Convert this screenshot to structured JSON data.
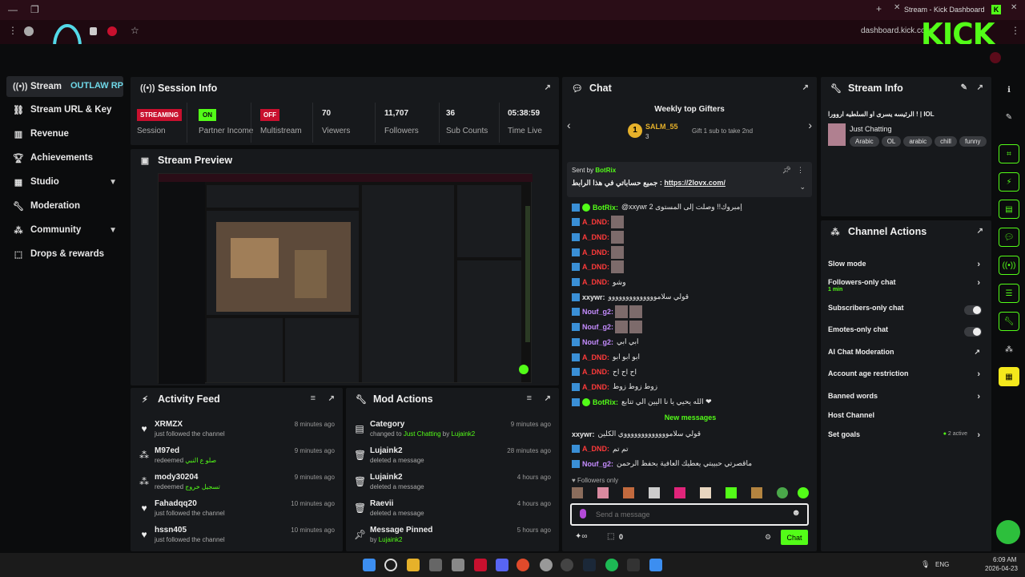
{
  "browser": {
    "tab_title": "Stream - Kick Dashboard",
    "url": "dashboard.kick.com",
    "overlay_logo": "KICK",
    "overlay_name": "OUTLAW RP"
  },
  "sidebar": {
    "items": [
      {
        "label": "Stream",
        "icon": "broadcast-icon"
      },
      {
        "label": "Stream URL & Key",
        "icon": "link-icon"
      },
      {
        "label": "Revenue",
        "icon": "chart-icon"
      },
      {
        "label": "Achievements",
        "icon": "trophy-icon"
      },
      {
        "label": "Studio",
        "icon": "studio-icon"
      },
      {
        "label": "Moderation",
        "icon": "wrench-icon"
      },
      {
        "label": "Community",
        "icon": "community-icon"
      },
      {
        "label": "Drops & rewards",
        "icon": "gift-icon"
      }
    ]
  },
  "session": {
    "title": "Session Info",
    "stats": [
      {
        "value": "STREAMING",
        "label": "Session"
      },
      {
        "value": "ON",
        "label": "Partner Income"
      },
      {
        "value": "OFF",
        "label": "Multistream"
      },
      {
        "value": "70",
        "label": "Viewers"
      },
      {
        "value": "11,707",
        "label": "Followers"
      },
      {
        "value": "36",
        "label": "Sub Counts"
      },
      {
        "value": "05:38:59",
        "label": "Time Live"
      }
    ]
  },
  "preview": {
    "title": "Stream Preview"
  },
  "activity": {
    "title": "Activity Feed",
    "rows": [
      {
        "name": "XRMZX",
        "sub": "just followed the channel",
        "extra": "",
        "time": "8 minutes ago",
        "icon": "heart-icon"
      },
      {
        "name": "M97ed",
        "sub": "redeemed",
        "extra": "صلو ع النبي",
        "time": "9 minutes ago",
        "icon": "redeem-icon"
      },
      {
        "name": "mody30204",
        "sub": "redeemed",
        "extra": "تسجيل خروج",
        "time": "9 minutes ago",
        "icon": "redeem-icon"
      },
      {
        "name": "Fahadqq20",
        "sub": "just followed the channel",
        "extra": "",
        "time": "10 minutes ago",
        "icon": "heart-icon"
      },
      {
        "name": "hssn405",
        "sub": "just followed the channel",
        "extra": "",
        "time": "10 minutes ago",
        "icon": "heart-icon"
      }
    ]
  },
  "mod": {
    "title": "Mod Actions",
    "rows": [
      {
        "name": "Category",
        "sub": "changed to",
        "extra": "Just Chatting",
        "by": "by",
        "who": "Lujaink2",
        "time": "9 minutes ago",
        "icon": "category-icon"
      },
      {
        "name": "Lujaink2",
        "sub": "deleted a message",
        "time": "28 minutes ago",
        "icon": "trash-icon"
      },
      {
        "name": "Lujaink2",
        "sub": "deleted a message",
        "time": "4 hours ago",
        "icon": "trash-icon"
      },
      {
        "name": "Raevii",
        "sub": "deleted a message",
        "time": "4 hours ago",
        "icon": "trash-icon"
      },
      {
        "name": "Message Pinned",
        "sub": "by",
        "who": "Lujaink2",
        "time": "5 hours ago",
        "icon": "pin-icon"
      }
    ]
  },
  "chat": {
    "title": "Chat",
    "gifters_title": "Weekly top Gifters",
    "top_gifter": "SALM_55",
    "top_gifter_count": "3",
    "gift_hint": "Gift 1 sub to take 2nd",
    "pinned_label": "Sent by",
    "pinned_user": "BotRix",
    "pinned_text": "جميع حساباتي في هذا الرابط :",
    "pinned_link": "https://2lovx.com/",
    "messages": [
      {
        "user": "BotRix",
        "cls": "u-grn",
        "text": "@xxywr 2 إمبروك!! وصلت إلى المستوى"
      },
      {
        "user": "A_DND",
        "cls": "u-red",
        "text": ""
      },
      {
        "user": "A_DND",
        "cls": "u-red",
        "text": ""
      },
      {
        "user": "A_DND",
        "cls": "u-red",
        "text": ""
      },
      {
        "user": "A_DND",
        "cls": "u-red",
        "text": ""
      },
      {
        "user": "A_DND",
        "cls": "u-red",
        "text": "وشو"
      },
      {
        "user": "xxywr",
        "cls": "u-wht",
        "text": "قولي سلاموووووووووووووو"
      },
      {
        "user": "Nouf_g2",
        "cls": "u-pur",
        "text": ""
      },
      {
        "user": "Nouf_g2",
        "cls": "u-pur",
        "text": ""
      },
      {
        "user": "Nouf_g2",
        "cls": "u-pur",
        "text": "ابي ابي"
      },
      {
        "user": "A_DND",
        "cls": "u-red",
        "text": "ابو ابو ابو"
      },
      {
        "user": "A_DND",
        "cls": "u-red",
        "text": "اح اح اح"
      },
      {
        "user": "A_DND",
        "cls": "u-red",
        "text": "زوط زوط زوط"
      },
      {
        "user": "BotRix",
        "cls": "u-grn",
        "text": "الله يحيي يا نا اليين الي تتابع ❤"
      }
    ],
    "new_messages_label": "New messages",
    "new_messages": [
      {
        "user": "xxywr",
        "cls": "u-wht",
        "text": "قولي سلاموووووووووووووي الكلين"
      },
      {
        "user": "A_DND",
        "cls": "u-red",
        "text": "تم تم"
      },
      {
        "user": "Nouf_g2",
        "cls": "u-pur",
        "text": "ماقصرتي حبيبتي يعطيك العافية بحفظ الرحمن"
      }
    ],
    "followers_only": "Followers only",
    "input_placeholder": "Send a message",
    "points": "0",
    "send_label": "Chat"
  },
  "stream_info": {
    "title": "Stream Info",
    "stream_title": "الرئيسه يسرى او السلطيه اروورا ! | IOL",
    "category": "Just Chatting",
    "tags": [
      "Arabic",
      "OL",
      "arabic",
      "chill",
      "funny"
    ]
  },
  "actions": {
    "title": "Channel Actions",
    "rows": [
      {
        "label": "Slow mode",
        "type": "chevron",
        "sub": ""
      },
      {
        "label": "Followers-only chat",
        "type": "chevron",
        "sub": "1 min"
      },
      {
        "label": "Subscribers-only chat",
        "type": "toggle",
        "sub": ""
      },
      {
        "label": "Emotes-only chat",
        "type": "toggle",
        "sub": ""
      },
      {
        "label": "AI Chat Moderation",
        "type": "popout",
        "sub": ""
      },
      {
        "label": "Account age restriction",
        "type": "chevron",
        "sub": ""
      },
      {
        "label": "Banned words",
        "type": "chevron",
        "sub": ""
      },
      {
        "label": "Host Channel",
        "type": "none",
        "sub": ""
      },
      {
        "label": "Set goals",
        "type": "chevron",
        "sub": "2 active"
      }
    ]
  },
  "taskbar": {
    "lang": "ENG",
    "time": "6:09 AM",
    "date": "2026-04-23"
  },
  "colors": {
    "accent": "#53fc18",
    "live": "#c8102e",
    "panel": "#17191c",
    "bg": "#0b0c0d"
  }
}
